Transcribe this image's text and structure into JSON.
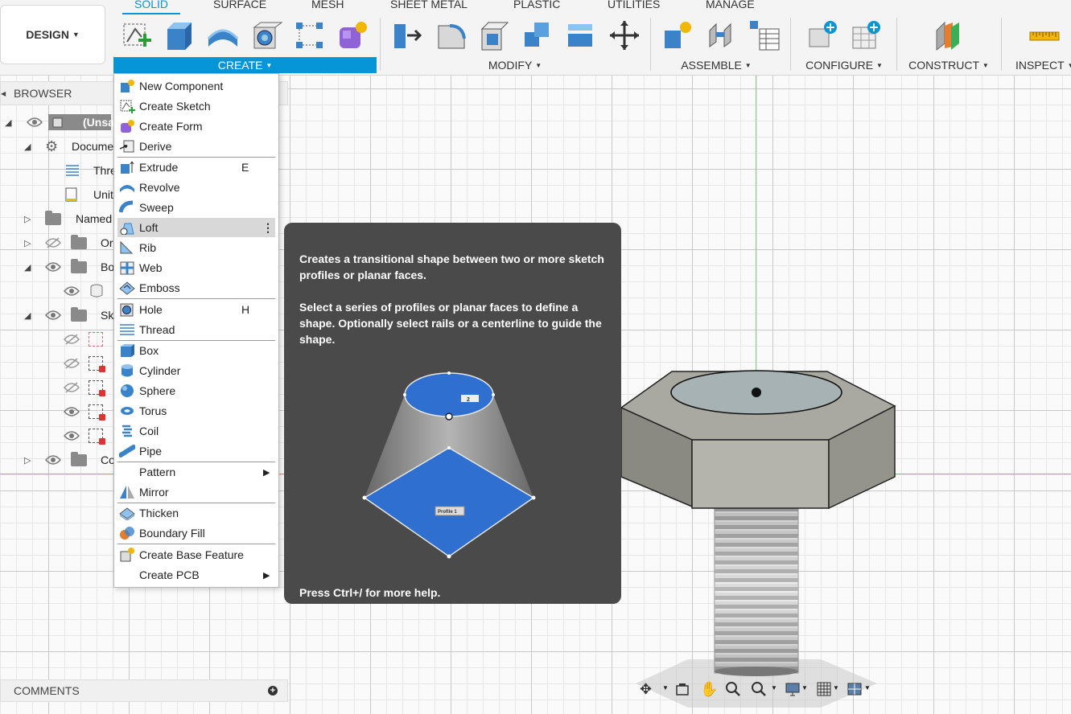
{
  "toolbar": {
    "design_label": "DESIGN",
    "tabs": [
      "SOLID",
      "SURFACE",
      "MESH",
      "SHEET METAL",
      "PLASTIC",
      "UTILITIES",
      "MANAGE"
    ],
    "groups": [
      "CREATE",
      "MODIFY",
      "ASSEMBLE",
      "CONFIGURE",
      "CONSTRUCT",
      "INSPECT"
    ]
  },
  "browser": {
    "title": "BROWSER",
    "rows": [
      "(Unsa",
      "Docume",
      "Thre",
      "Unit",
      "Named",
      "Or",
      "Bo",
      "Sk",
      "Co"
    ]
  },
  "comments": {
    "title": "COMMENTS"
  },
  "create_menu": {
    "items": [
      {
        "label": "New Component",
        "icon": "new-component-icon"
      },
      {
        "label": "Create Sketch",
        "icon": "create-sketch-icon"
      },
      {
        "label": "Create Form",
        "icon": "create-form-icon"
      },
      {
        "label": "Derive",
        "icon": "derive-icon"
      },
      {
        "label": "Extrude",
        "shortcut": "E",
        "icon": "extrude-icon"
      },
      {
        "label": "Revolve",
        "icon": "revolve-icon"
      },
      {
        "label": "Sweep",
        "icon": "sweep-icon"
      },
      {
        "label": "Loft",
        "icon": "loft-icon"
      },
      {
        "label": "Rib",
        "icon": "rib-icon"
      },
      {
        "label": "Web",
        "icon": "web-icon"
      },
      {
        "label": "Emboss",
        "icon": "emboss-icon"
      },
      {
        "label": "Hole",
        "shortcut": "H",
        "icon": "hole-icon"
      },
      {
        "label": "Thread",
        "icon": "thread-icon"
      },
      {
        "label": "Box",
        "icon": "box-icon"
      },
      {
        "label": "Cylinder",
        "icon": "cylinder-icon"
      },
      {
        "label": "Sphere",
        "icon": "sphere-icon"
      },
      {
        "label": "Torus",
        "icon": "torus-icon"
      },
      {
        "label": "Coil",
        "icon": "coil-icon"
      },
      {
        "label": "Pipe",
        "icon": "pipe-icon"
      },
      {
        "label": "Pattern",
        "icon": "chevron-right-icon"
      },
      {
        "label": "Mirror",
        "icon": "mirror-icon"
      },
      {
        "label": "Thicken",
        "icon": "thicken-icon"
      },
      {
        "label": "Boundary Fill",
        "icon": "boundary-fill-icon"
      },
      {
        "label": "Create Base Feature",
        "icon": "create-base-feature-icon"
      },
      {
        "label": "Create PCB",
        "icon": "chevron-right-icon"
      }
    ],
    "highlighted": "Loft"
  },
  "tooltip": {
    "para1": "Creates a transitional shape between two or more sketch profiles or planar faces.",
    "para2": "Select a series of profiles or planar faces to define a shape. Optionally select rails or a centerline to guide the shape.",
    "footer": "Press Ctrl+/ for more help.",
    "illustration_profile_label": "Profile 1",
    "illustration_top_label": "2"
  },
  "colors": {
    "accent": "#0696d7",
    "tooltip_bg": "#4a4a4a",
    "menu_highlight": "#d8d8d8"
  }
}
